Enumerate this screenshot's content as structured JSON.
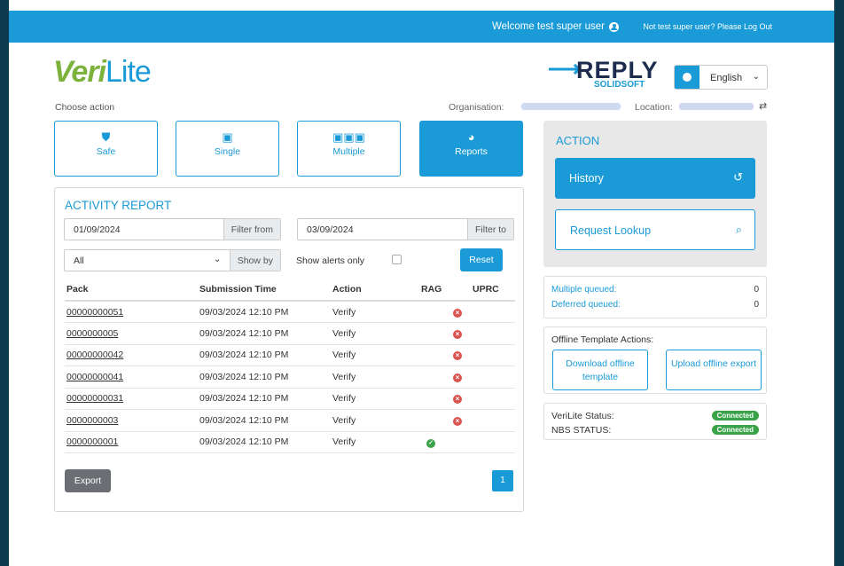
{
  "header": {
    "welcome_text": "Welcome  test super user",
    "logout_text": "Not test super user? Please Log Out"
  },
  "brand": {
    "logo_main": "Veri",
    "logo_suffix": "Lite",
    "partner_word": "REPLY",
    "partner_sub": "SOLIDSOFT"
  },
  "toolbar": {
    "choose_label": "Choose action",
    "organisation_label": "Organisation:",
    "location_label": "Location:",
    "language": "English"
  },
  "nav": {
    "items": [
      {
        "label": "Safe",
        "icon": "shield-icon"
      },
      {
        "label": "Single",
        "icon": "single-pack-icon"
      },
      {
        "label": "Multiple",
        "icon": "multiple-packs-icon"
      },
      {
        "label": "Reports",
        "icon": "pie-chart-icon",
        "active": true
      }
    ]
  },
  "report": {
    "title": "ACTIVITY REPORT",
    "filter_from_value": "01/09/2024",
    "filter_from_label": "Filter from",
    "filter_to_value": "03/09/2024",
    "filter_to_label": "Filter to",
    "show_by_value": "All",
    "show_by_label": "Show by",
    "alerts_label": "Show alerts only",
    "reset_label": "Reset",
    "columns": [
      "Pack",
      "Submission Time",
      "Action",
      "RAG",
      "UPRC"
    ],
    "rows": [
      {
        "pack": "00000000051",
        "time": "09/03/2024 12:10 PM",
        "action": "Verify",
        "rag": "red"
      },
      {
        "pack": "0000000005",
        "time": "09/03/2024 12:10 PM",
        "action": "Verify",
        "rag": "red"
      },
      {
        "pack": "00000000042",
        "time": "09/03/2024 12:10 PM",
        "action": "Verify",
        "rag": "red"
      },
      {
        "pack": "00000000041",
        "time": "09/03/2024 12:10 PM",
        "action": "Verify",
        "rag": "red"
      },
      {
        "pack": "00000000031",
        "time": "09/03/2024 12:10 PM",
        "action": "Verify",
        "rag": "red"
      },
      {
        "pack": "0000000003",
        "time": "09/03/2024 12:10 PM",
        "action": "Verify",
        "rag": "red"
      },
      {
        "pack": "0000000001",
        "time": "09/03/2024 12:10 PM",
        "action": "Verify",
        "rag": "green"
      }
    ],
    "export_label": "Export",
    "page": "1"
  },
  "action_panel": {
    "title": "ACTION",
    "history_label": "History",
    "lookup_label": "Request Lookup"
  },
  "queue": {
    "multiple_label": "Multiple queued:",
    "multiple_count": "0",
    "deferred_label": "Deferred queued:",
    "deferred_count": "0"
  },
  "offline": {
    "title": "Offline Template Actions:",
    "download_label": "Download offline template",
    "upload_label": "Upload offline export"
  },
  "status": {
    "verilite_label": "VeriLite Status:",
    "verilite_value": "Connected",
    "nbs_label": "NBS STATUS:",
    "nbs_value": "Connected"
  },
  "colors": {
    "accent": "#1a9ad6",
    "brand_green": "#7cb23b",
    "ok": "#3aa34a",
    "error": "#d9534f",
    "frame": "#0b3b4c"
  }
}
